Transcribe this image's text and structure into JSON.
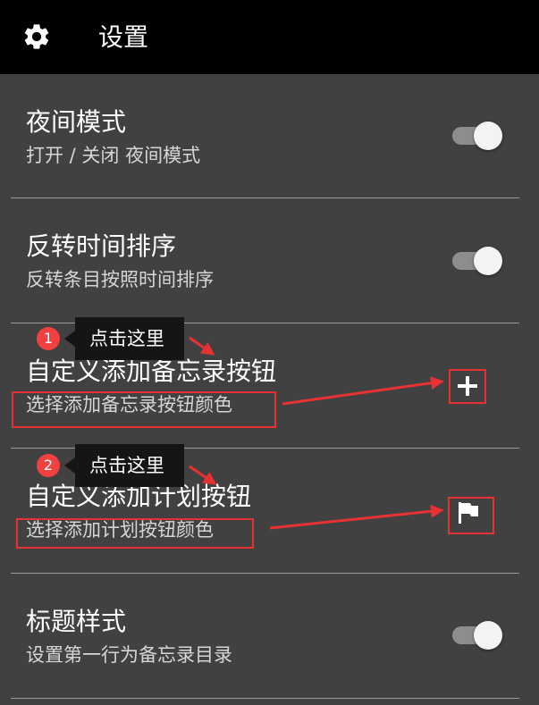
{
  "header": {
    "title": "设置",
    "icon": "gear-icon"
  },
  "settings": [
    {
      "title": "夜间模式",
      "subtitle": "打开 / 关闭 夜间模式",
      "control": "toggle",
      "on": true
    },
    {
      "title": "反转时间排序",
      "subtitle": "反转条目按照时间排序",
      "control": "toggle",
      "on": true
    },
    {
      "title": "自定义添加备忘录按钮",
      "subtitle": "选择添加备忘录按钮颜色",
      "control": "icon",
      "icon": "plus-icon"
    },
    {
      "title": "自定义添加计划按钮",
      "subtitle": "选择添加计划按钮颜色",
      "control": "icon",
      "icon": "flag-icon"
    },
    {
      "title": "标题样式",
      "subtitle": "设置第一行为备忘录目录",
      "control": "toggle",
      "on": true
    }
  ],
  "annotations": [
    {
      "number": "1",
      "text": "点击这里"
    },
    {
      "number": "2",
      "text": "点击这里"
    }
  ],
  "colors": {
    "header_bg": "#000000",
    "page_bg": "#414141",
    "annotation_red": "#e63232",
    "toggle_knob": "#f3f3f3"
  }
}
